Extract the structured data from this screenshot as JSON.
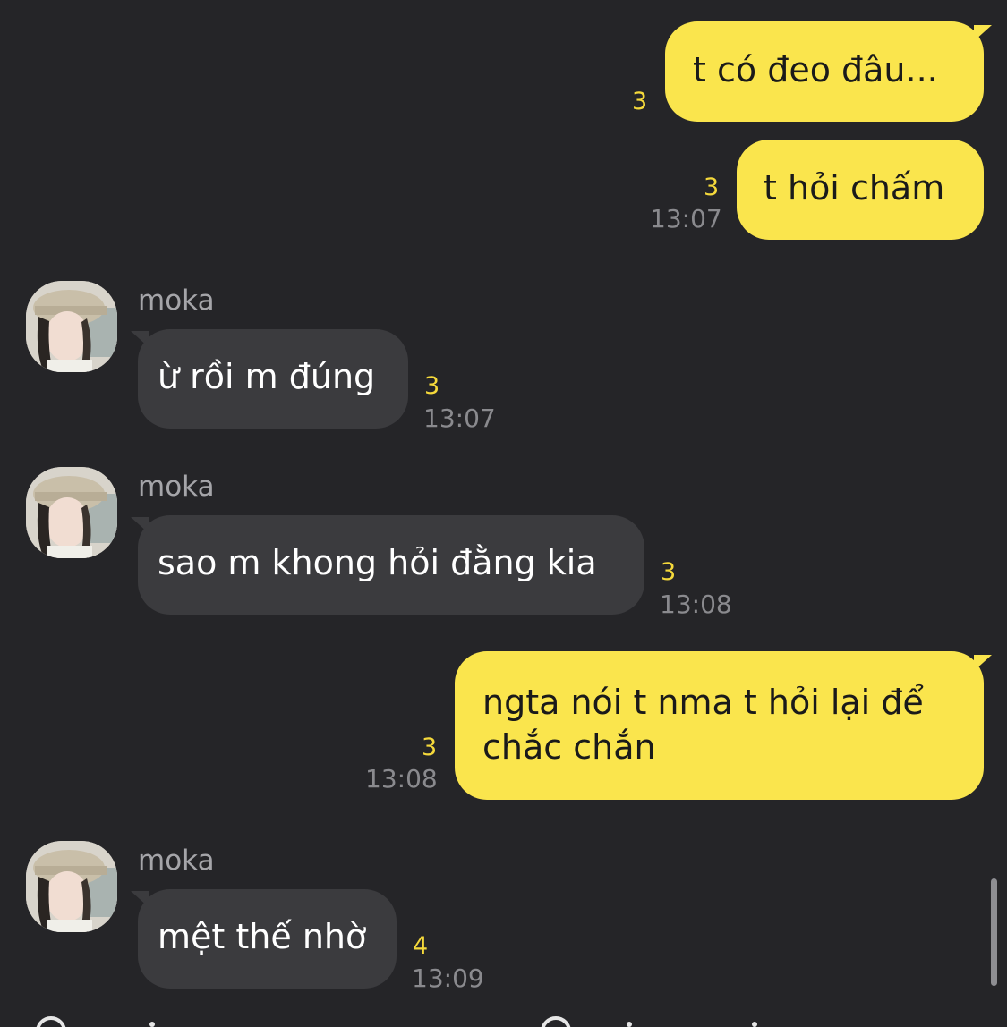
{
  "messages": [
    {
      "side": "out",
      "text": "t có đeo đâu...",
      "count": "3",
      "time": ""
    },
    {
      "side": "out",
      "text": "t hỏi chấm",
      "count": "3",
      "time": "13:07"
    },
    {
      "side": "in",
      "sender": "moka",
      "text": "ừ rồi m đúng",
      "count": "3",
      "time": "13:07"
    },
    {
      "side": "in",
      "sender": "moka",
      "text": "sao m khong hỏi đằng kia",
      "count": "3",
      "time": "13:08"
    },
    {
      "side": "out",
      "lines": [
        "ngta nói t nma t hỏi lại để",
        "chắc chắn"
      ],
      "count": "3",
      "time": "13:08"
    },
    {
      "side": "in",
      "sender": "moka",
      "text": "mệt thế nhờ",
      "count": "4",
      "time": "13:09"
    }
  ],
  "colors": {
    "background": "#252528",
    "outgoing_bubble": "#fae54d",
    "incoming_bubble": "#3b3b3e",
    "unread_count": "#f5d93b"
  }
}
